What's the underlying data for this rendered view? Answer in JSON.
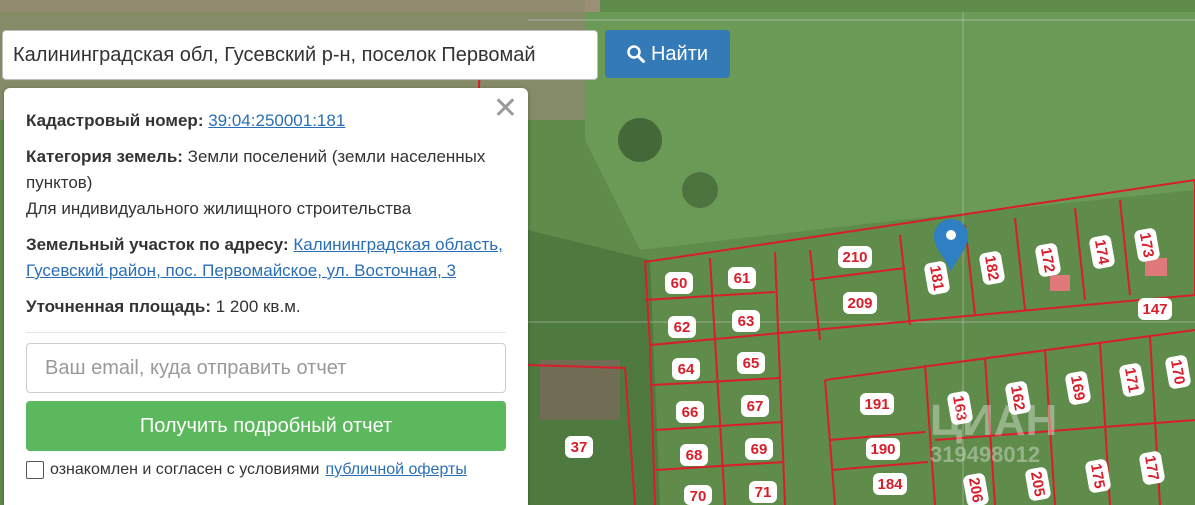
{
  "search": {
    "query": "Калининградская обл, Гусевский р-н, поселок Первомай",
    "button_label": "Найти",
    "icon": "search-icon"
  },
  "info": {
    "cadastral_label": "Кадастровый номер:",
    "cadastral_value": "39:04:250001:181",
    "category_label": "Категория земель:",
    "category_value": "Земли поселений (земли населенных пунктов)",
    "usage_value": "Для индивидуального жилищного строительства",
    "address_label": "Земельный участок по адресу:",
    "address_value": "Калининградская область, Гусевский район, пос. Первомайское, ул. Восточная, 3",
    "area_label": "Уточненная площадь:",
    "area_value": "1 200 кв.м."
  },
  "form": {
    "email_placeholder": "Ваш email, куда отправить отчет",
    "submit_label": "Получить подробный отчет",
    "agree_text": "ознакомлен и согласен с условиями",
    "agree_link": "публичной оферты"
  },
  "map": {
    "plot_labels": [
      "210",
      "181",
      "182",
      "172",
      "174",
      "173",
      "147",
      "209",
      "60",
      "61",
      "62",
      "63",
      "64",
      "65",
      "66",
      "67",
      "68",
      "69",
      "70",
      "71",
      "37",
      "191",
      "163",
      "162",
      "169",
      "171",
      "170",
      "190",
      "184",
      "206",
      "205",
      "175",
      "177"
    ],
    "watermark": "ЦИАН",
    "watermark_id": "319498012",
    "colors": {
      "grass": "#5e8a4a",
      "boundary": "#d81e2a",
      "accent_blue": "#337ab7",
      "green_btn": "#5cb85c"
    }
  }
}
